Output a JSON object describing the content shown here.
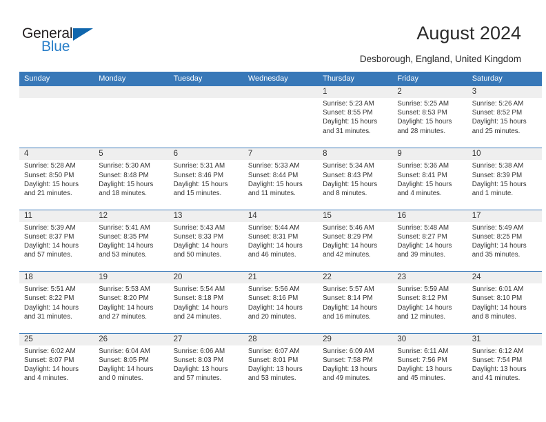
{
  "brand": {
    "name_part1": "General",
    "name_part2": "Blue",
    "triangle_icon": "triangle-icon",
    "colors": {
      "dark": "#231f20",
      "blue": "#2a7fc9",
      "triangle": "#1066ad"
    }
  },
  "header": {
    "title": "August 2024",
    "subtitle": "Desborough, England, United Kingdom"
  },
  "calendar": {
    "accent_color": "#3878b8",
    "band_color": "#efefef",
    "weekdays": [
      "Sunday",
      "Monday",
      "Tuesday",
      "Wednesday",
      "Thursday",
      "Friday",
      "Saturday"
    ],
    "weeks": [
      [
        {
          "day": "",
          "sunrise": "",
          "sunset": "",
          "daylight1": "",
          "daylight2": ""
        },
        {
          "day": "",
          "sunrise": "",
          "sunset": "",
          "daylight1": "",
          "daylight2": ""
        },
        {
          "day": "",
          "sunrise": "",
          "sunset": "",
          "daylight1": "",
          "daylight2": ""
        },
        {
          "day": "",
          "sunrise": "",
          "sunset": "",
          "daylight1": "",
          "daylight2": ""
        },
        {
          "day": "1",
          "sunrise": "Sunrise: 5:23 AM",
          "sunset": "Sunset: 8:55 PM",
          "daylight1": "Daylight: 15 hours",
          "daylight2": "and 31 minutes."
        },
        {
          "day": "2",
          "sunrise": "Sunrise: 5:25 AM",
          "sunset": "Sunset: 8:53 PM",
          "daylight1": "Daylight: 15 hours",
          "daylight2": "and 28 minutes."
        },
        {
          "day": "3",
          "sunrise": "Sunrise: 5:26 AM",
          "sunset": "Sunset: 8:52 PM",
          "daylight1": "Daylight: 15 hours",
          "daylight2": "and 25 minutes."
        }
      ],
      [
        {
          "day": "4",
          "sunrise": "Sunrise: 5:28 AM",
          "sunset": "Sunset: 8:50 PM",
          "daylight1": "Daylight: 15 hours",
          "daylight2": "and 21 minutes."
        },
        {
          "day": "5",
          "sunrise": "Sunrise: 5:30 AM",
          "sunset": "Sunset: 8:48 PM",
          "daylight1": "Daylight: 15 hours",
          "daylight2": "and 18 minutes."
        },
        {
          "day": "6",
          "sunrise": "Sunrise: 5:31 AM",
          "sunset": "Sunset: 8:46 PM",
          "daylight1": "Daylight: 15 hours",
          "daylight2": "and 15 minutes."
        },
        {
          "day": "7",
          "sunrise": "Sunrise: 5:33 AM",
          "sunset": "Sunset: 8:44 PM",
          "daylight1": "Daylight: 15 hours",
          "daylight2": "and 11 minutes."
        },
        {
          "day": "8",
          "sunrise": "Sunrise: 5:34 AM",
          "sunset": "Sunset: 8:43 PM",
          "daylight1": "Daylight: 15 hours",
          "daylight2": "and 8 minutes."
        },
        {
          "day": "9",
          "sunrise": "Sunrise: 5:36 AM",
          "sunset": "Sunset: 8:41 PM",
          "daylight1": "Daylight: 15 hours",
          "daylight2": "and 4 minutes."
        },
        {
          "day": "10",
          "sunrise": "Sunrise: 5:38 AM",
          "sunset": "Sunset: 8:39 PM",
          "daylight1": "Daylight: 15 hours",
          "daylight2": "and 1 minute."
        }
      ],
      [
        {
          "day": "11",
          "sunrise": "Sunrise: 5:39 AM",
          "sunset": "Sunset: 8:37 PM",
          "daylight1": "Daylight: 14 hours",
          "daylight2": "and 57 minutes."
        },
        {
          "day": "12",
          "sunrise": "Sunrise: 5:41 AM",
          "sunset": "Sunset: 8:35 PM",
          "daylight1": "Daylight: 14 hours",
          "daylight2": "and 53 minutes."
        },
        {
          "day": "13",
          "sunrise": "Sunrise: 5:43 AM",
          "sunset": "Sunset: 8:33 PM",
          "daylight1": "Daylight: 14 hours",
          "daylight2": "and 50 minutes."
        },
        {
          "day": "14",
          "sunrise": "Sunrise: 5:44 AM",
          "sunset": "Sunset: 8:31 PM",
          "daylight1": "Daylight: 14 hours",
          "daylight2": "and 46 minutes."
        },
        {
          "day": "15",
          "sunrise": "Sunrise: 5:46 AM",
          "sunset": "Sunset: 8:29 PM",
          "daylight1": "Daylight: 14 hours",
          "daylight2": "and 42 minutes."
        },
        {
          "day": "16",
          "sunrise": "Sunrise: 5:48 AM",
          "sunset": "Sunset: 8:27 PM",
          "daylight1": "Daylight: 14 hours",
          "daylight2": "and 39 minutes."
        },
        {
          "day": "17",
          "sunrise": "Sunrise: 5:49 AM",
          "sunset": "Sunset: 8:25 PM",
          "daylight1": "Daylight: 14 hours",
          "daylight2": "and 35 minutes."
        }
      ],
      [
        {
          "day": "18",
          "sunrise": "Sunrise: 5:51 AM",
          "sunset": "Sunset: 8:22 PM",
          "daylight1": "Daylight: 14 hours",
          "daylight2": "and 31 minutes."
        },
        {
          "day": "19",
          "sunrise": "Sunrise: 5:53 AM",
          "sunset": "Sunset: 8:20 PM",
          "daylight1": "Daylight: 14 hours",
          "daylight2": "and 27 minutes."
        },
        {
          "day": "20",
          "sunrise": "Sunrise: 5:54 AM",
          "sunset": "Sunset: 8:18 PM",
          "daylight1": "Daylight: 14 hours",
          "daylight2": "and 24 minutes."
        },
        {
          "day": "21",
          "sunrise": "Sunrise: 5:56 AM",
          "sunset": "Sunset: 8:16 PM",
          "daylight1": "Daylight: 14 hours",
          "daylight2": "and 20 minutes."
        },
        {
          "day": "22",
          "sunrise": "Sunrise: 5:57 AM",
          "sunset": "Sunset: 8:14 PM",
          "daylight1": "Daylight: 14 hours",
          "daylight2": "and 16 minutes."
        },
        {
          "day": "23",
          "sunrise": "Sunrise: 5:59 AM",
          "sunset": "Sunset: 8:12 PM",
          "daylight1": "Daylight: 14 hours",
          "daylight2": "and 12 minutes."
        },
        {
          "day": "24",
          "sunrise": "Sunrise: 6:01 AM",
          "sunset": "Sunset: 8:10 PM",
          "daylight1": "Daylight: 14 hours",
          "daylight2": "and 8 minutes."
        }
      ],
      [
        {
          "day": "25",
          "sunrise": "Sunrise: 6:02 AM",
          "sunset": "Sunset: 8:07 PM",
          "daylight1": "Daylight: 14 hours",
          "daylight2": "and 4 minutes."
        },
        {
          "day": "26",
          "sunrise": "Sunrise: 6:04 AM",
          "sunset": "Sunset: 8:05 PM",
          "daylight1": "Daylight: 14 hours",
          "daylight2": "and 0 minutes."
        },
        {
          "day": "27",
          "sunrise": "Sunrise: 6:06 AM",
          "sunset": "Sunset: 8:03 PM",
          "daylight1": "Daylight: 13 hours",
          "daylight2": "and 57 minutes."
        },
        {
          "day": "28",
          "sunrise": "Sunrise: 6:07 AM",
          "sunset": "Sunset: 8:01 PM",
          "daylight1": "Daylight: 13 hours",
          "daylight2": "and 53 minutes."
        },
        {
          "day": "29",
          "sunrise": "Sunrise: 6:09 AM",
          "sunset": "Sunset: 7:58 PM",
          "daylight1": "Daylight: 13 hours",
          "daylight2": "and 49 minutes."
        },
        {
          "day": "30",
          "sunrise": "Sunrise: 6:11 AM",
          "sunset": "Sunset: 7:56 PM",
          "daylight1": "Daylight: 13 hours",
          "daylight2": "and 45 minutes."
        },
        {
          "day": "31",
          "sunrise": "Sunrise: 6:12 AM",
          "sunset": "Sunset: 7:54 PM",
          "daylight1": "Daylight: 13 hours",
          "daylight2": "and 41 minutes."
        }
      ]
    ]
  }
}
